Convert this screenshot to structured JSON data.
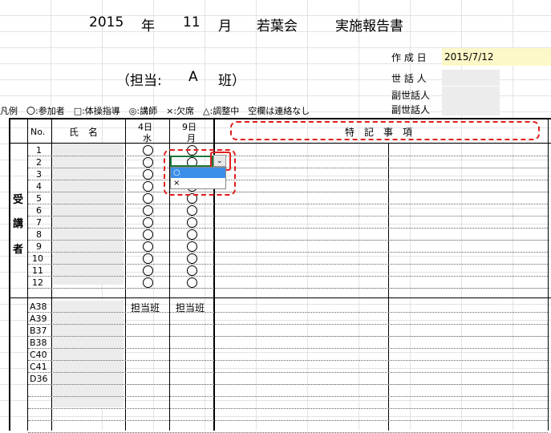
{
  "header": {
    "year": "2015",
    "year_unit": "年",
    "month": "11",
    "month_unit": "月",
    "org": "若葉会",
    "doc_title": "実施報告書",
    "charge_label": "（担当:",
    "charge_group": "A",
    "charge_suffix": "班）"
  },
  "meta": {
    "created_label": "作 成 日",
    "created_value": "2015/7/12",
    "caretaker_label": "世 話 人",
    "vice1_label": "副世話人",
    "vice2_label": "副世話人"
  },
  "legend": "凡例　〇:参加者　□:体操指導　◎:講師　×:欠席　△:調整中　空欄は連絡なし",
  "table": {
    "col_no": "No.",
    "col_name": "氏　名",
    "col_d1_top": "4日",
    "col_d1_bot": "水",
    "col_d2_top": "9日",
    "col_d2_bot": "月",
    "col_notes": "特　記　事　項",
    "side_label": [
      "受",
      "講",
      "者"
    ],
    "rows_top": [
      "1",
      "2",
      "3",
      "4",
      "5",
      "6",
      "7",
      "8",
      "9",
      "10",
      "11",
      "12"
    ],
    "rows_bottom": [
      "A38",
      "A39",
      "B37",
      "B38",
      "C40",
      "C41",
      "D36"
    ],
    "bottom_d1": "担当班",
    "bottom_d2": "担当班"
  },
  "dropdown": {
    "options": [
      "○",
      "×"
    ],
    "selected_index": 0
  }
}
